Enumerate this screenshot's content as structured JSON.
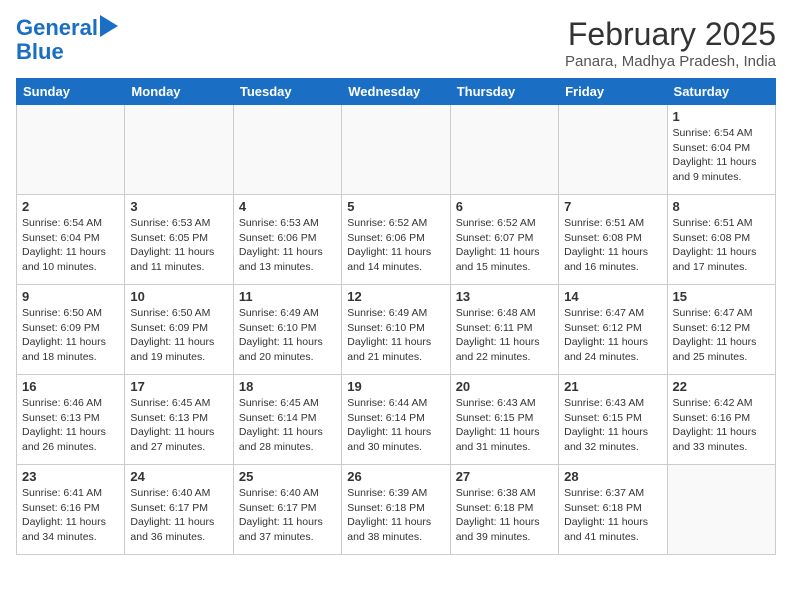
{
  "header": {
    "logo_line1": "General",
    "logo_line2": "Blue",
    "month": "February 2025",
    "location": "Panara, Madhya Pradesh, India"
  },
  "weekdays": [
    "Sunday",
    "Monday",
    "Tuesday",
    "Wednesday",
    "Thursday",
    "Friday",
    "Saturday"
  ],
  "weeks": [
    [
      {
        "day": "",
        "info": ""
      },
      {
        "day": "",
        "info": ""
      },
      {
        "day": "",
        "info": ""
      },
      {
        "day": "",
        "info": ""
      },
      {
        "day": "",
        "info": ""
      },
      {
        "day": "",
        "info": ""
      },
      {
        "day": "1",
        "info": "Sunrise: 6:54 AM\nSunset: 6:04 PM\nDaylight: 11 hours\nand 9 minutes."
      }
    ],
    [
      {
        "day": "2",
        "info": "Sunrise: 6:54 AM\nSunset: 6:04 PM\nDaylight: 11 hours\nand 10 minutes."
      },
      {
        "day": "3",
        "info": "Sunrise: 6:53 AM\nSunset: 6:05 PM\nDaylight: 11 hours\nand 11 minutes."
      },
      {
        "day": "4",
        "info": "Sunrise: 6:53 AM\nSunset: 6:06 PM\nDaylight: 11 hours\nand 13 minutes."
      },
      {
        "day": "5",
        "info": "Sunrise: 6:52 AM\nSunset: 6:06 PM\nDaylight: 11 hours\nand 14 minutes."
      },
      {
        "day": "6",
        "info": "Sunrise: 6:52 AM\nSunset: 6:07 PM\nDaylight: 11 hours\nand 15 minutes."
      },
      {
        "day": "7",
        "info": "Sunrise: 6:51 AM\nSunset: 6:08 PM\nDaylight: 11 hours\nand 16 minutes."
      },
      {
        "day": "8",
        "info": "Sunrise: 6:51 AM\nSunset: 6:08 PM\nDaylight: 11 hours\nand 17 minutes."
      }
    ],
    [
      {
        "day": "9",
        "info": "Sunrise: 6:50 AM\nSunset: 6:09 PM\nDaylight: 11 hours\nand 18 minutes."
      },
      {
        "day": "10",
        "info": "Sunrise: 6:50 AM\nSunset: 6:09 PM\nDaylight: 11 hours\nand 19 minutes."
      },
      {
        "day": "11",
        "info": "Sunrise: 6:49 AM\nSunset: 6:10 PM\nDaylight: 11 hours\nand 20 minutes."
      },
      {
        "day": "12",
        "info": "Sunrise: 6:49 AM\nSunset: 6:10 PM\nDaylight: 11 hours\nand 21 minutes."
      },
      {
        "day": "13",
        "info": "Sunrise: 6:48 AM\nSunset: 6:11 PM\nDaylight: 11 hours\nand 22 minutes."
      },
      {
        "day": "14",
        "info": "Sunrise: 6:47 AM\nSunset: 6:12 PM\nDaylight: 11 hours\nand 24 minutes."
      },
      {
        "day": "15",
        "info": "Sunrise: 6:47 AM\nSunset: 6:12 PM\nDaylight: 11 hours\nand 25 minutes."
      }
    ],
    [
      {
        "day": "16",
        "info": "Sunrise: 6:46 AM\nSunset: 6:13 PM\nDaylight: 11 hours\nand 26 minutes."
      },
      {
        "day": "17",
        "info": "Sunrise: 6:45 AM\nSunset: 6:13 PM\nDaylight: 11 hours\nand 27 minutes."
      },
      {
        "day": "18",
        "info": "Sunrise: 6:45 AM\nSunset: 6:14 PM\nDaylight: 11 hours\nand 28 minutes."
      },
      {
        "day": "19",
        "info": "Sunrise: 6:44 AM\nSunset: 6:14 PM\nDaylight: 11 hours\nand 30 minutes."
      },
      {
        "day": "20",
        "info": "Sunrise: 6:43 AM\nSunset: 6:15 PM\nDaylight: 11 hours\nand 31 minutes."
      },
      {
        "day": "21",
        "info": "Sunrise: 6:43 AM\nSunset: 6:15 PM\nDaylight: 11 hours\nand 32 minutes."
      },
      {
        "day": "22",
        "info": "Sunrise: 6:42 AM\nSunset: 6:16 PM\nDaylight: 11 hours\nand 33 minutes."
      }
    ],
    [
      {
        "day": "23",
        "info": "Sunrise: 6:41 AM\nSunset: 6:16 PM\nDaylight: 11 hours\nand 34 minutes."
      },
      {
        "day": "24",
        "info": "Sunrise: 6:40 AM\nSunset: 6:17 PM\nDaylight: 11 hours\nand 36 minutes."
      },
      {
        "day": "25",
        "info": "Sunrise: 6:40 AM\nSunset: 6:17 PM\nDaylight: 11 hours\nand 37 minutes."
      },
      {
        "day": "26",
        "info": "Sunrise: 6:39 AM\nSunset: 6:18 PM\nDaylight: 11 hours\nand 38 minutes."
      },
      {
        "day": "27",
        "info": "Sunrise: 6:38 AM\nSunset: 6:18 PM\nDaylight: 11 hours\nand 39 minutes."
      },
      {
        "day": "28",
        "info": "Sunrise: 6:37 AM\nSunset: 6:18 PM\nDaylight: 11 hours\nand 41 minutes."
      },
      {
        "day": "",
        "info": ""
      }
    ]
  ]
}
